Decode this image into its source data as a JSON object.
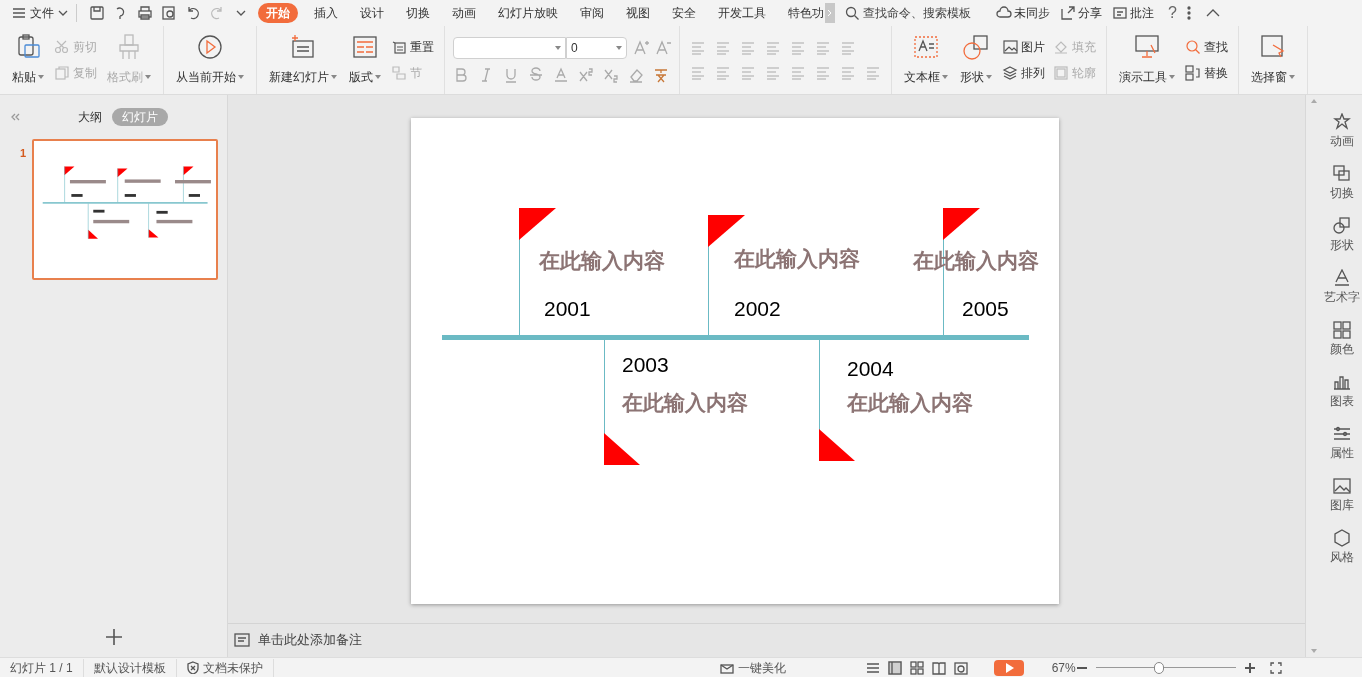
{
  "menu_bar": {
    "file_menu": "文件",
    "tabs": [
      {
        "label": "开始",
        "selected": true
      },
      {
        "label": "插入",
        "selected": false
      },
      {
        "label": "设计",
        "selected": false
      },
      {
        "label": "切换",
        "selected": false
      },
      {
        "label": "动画",
        "selected": false
      },
      {
        "label": "幻灯片放映",
        "selected": false
      },
      {
        "label": "审阅",
        "selected": false
      },
      {
        "label": "视图",
        "selected": false
      },
      {
        "label": "安全",
        "selected": false
      },
      {
        "label": "开发工具",
        "selected": false
      },
      {
        "label": "特色功",
        "selected": false
      }
    ],
    "search": {
      "placeholder": "查找命令、搜索模板"
    },
    "actions": [
      "未同步",
      "分享",
      "批注",
      "?"
    ]
  },
  "ribbon": {
    "groups": [
      {
        "kind": "buttons",
        "items": [
          {
            "label": "粘贴",
            "kind": "large",
            "disabled": false
          },
          {
            "label": "剪切",
            "kind": "small",
            "disabled": true
          },
          {
            "label": "复制",
            "kind": "small",
            "disabled": true
          },
          {
            "label": "格式刷",
            "kind": "large",
            "disabled": true
          }
        ]
      },
      {
        "kind": "buttons",
        "items": [
          {
            "label": "从当前开始",
            "kind": "large",
            "disabled": false
          }
        ]
      },
      {
        "kind": "buttons",
        "items": [
          {
            "label": "新建幻灯片",
            "kind": "large",
            "disabled": false
          },
          {
            "label": "版式",
            "kind": "large",
            "disabled": false
          },
          {
            "label": "重置",
            "kind": "small",
            "disabled": false
          },
          {
            "label": "节",
            "kind": "small",
            "disabled": true
          }
        ]
      },
      {
        "kind": "font",
        "font_size": "0"
      },
      {
        "kind": "paragraph"
      },
      {
        "kind": "buttons",
        "items": [
          {
            "label": "文本框",
            "kind": "large",
            "disabled": false
          },
          {
            "label": "形状",
            "kind": "large",
            "disabled": false
          },
          {
            "label": "图片",
            "kind": "small",
            "disabled": false
          },
          {
            "label": "排列",
            "kind": "small",
            "disabled": false
          },
          {
            "label": "填充",
            "kind": "small",
            "disabled": true
          },
          {
            "label": "轮廓",
            "kind": "small",
            "disabled": true
          }
        ]
      },
      {
        "kind": "buttons",
        "items": [
          {
            "label": "演示工具",
            "kind": "large",
            "disabled": false
          },
          {
            "label": "查找",
            "kind": "small",
            "disabled": false
          },
          {
            "label": "替换",
            "kind": "small",
            "disabled": false
          }
        ]
      },
      {
        "kind": "buttons",
        "items": [
          {
            "label": "选择窗",
            "kind": "large",
            "disabled": false
          }
        ]
      }
    ]
  },
  "left_panel": {
    "tabs": [
      {
        "label": "大纲",
        "selected": false
      },
      {
        "label": "幻灯片",
        "selected": true
      }
    ],
    "slides": [
      {
        "number": "1",
        "selected": true
      }
    ]
  },
  "slide": {
    "timeline": [
      {
        "year": "2001",
        "text": "在此输入内容"
      },
      {
        "year": "2002",
        "text": "在此输入内容"
      },
      {
        "year": "2005",
        "text": "在此输入内容"
      },
      {
        "year": "2003",
        "text": "在此输入内容"
      },
      {
        "year": "2004",
        "text": "在此输入内容"
      }
    ]
  },
  "notes": {
    "placeholder": "单击此处添加备注"
  },
  "right_sidebar": [
    "动画",
    "切换",
    "形状",
    "艺术字",
    "颜色",
    "图表",
    "属性",
    "图库",
    "风格"
  ],
  "status_bar": {
    "slide_count": "幻灯片 1 / 1",
    "template": "默认设计模板",
    "protection": "文档未保护",
    "beautify": "一键美化",
    "zoom": "67%",
    "zoom_slider": {
      "level": 0.45
    }
  }
}
